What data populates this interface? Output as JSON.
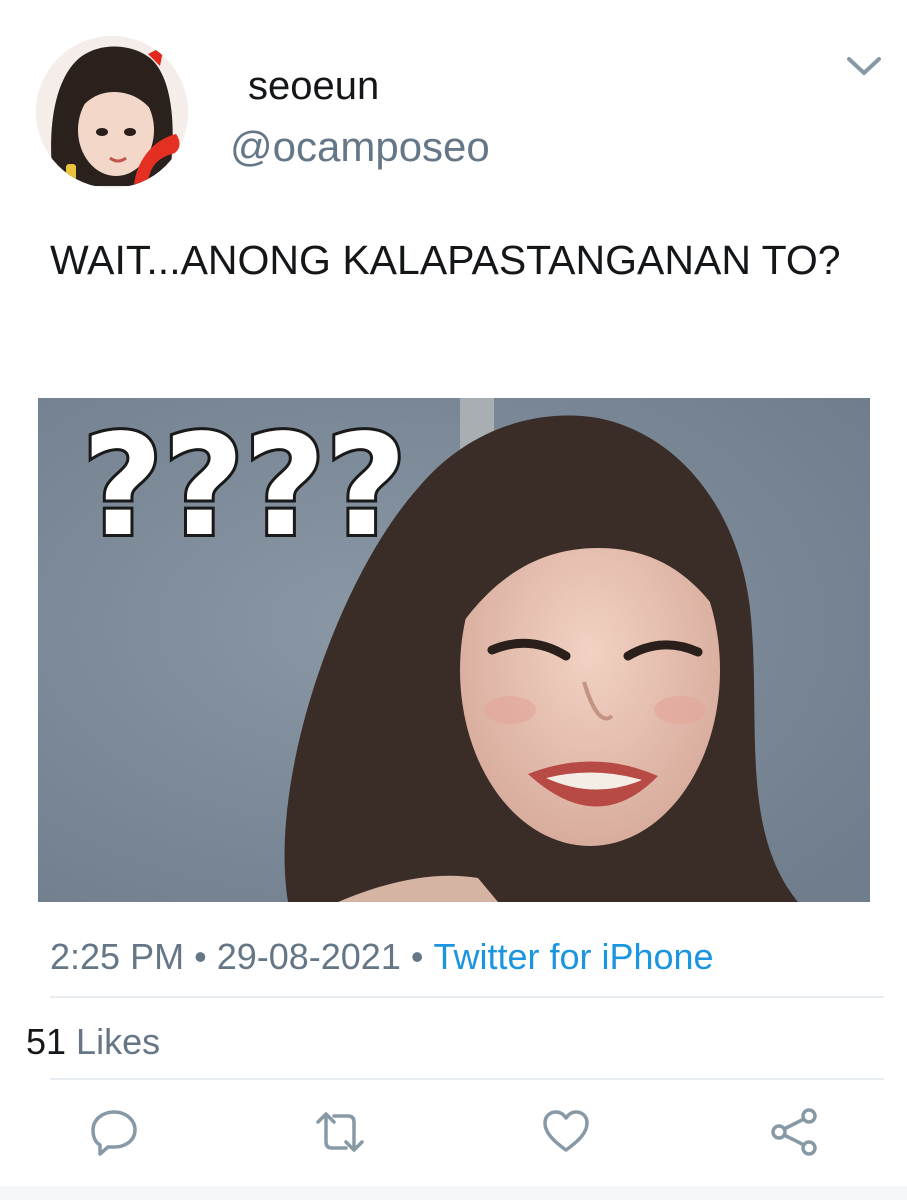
{
  "author": {
    "display_name": "seoeun",
    "handle": "@ocamposeo"
  },
  "tweet": {
    "text": "WAIT...ANONG KALAPASTANGANAN TO?",
    "media_overlay_text": "????"
  },
  "meta": {
    "time": "2:25 PM",
    "separator": "•",
    "date": "29-08-2021",
    "source": "Twitter for iPhone"
  },
  "stats": {
    "likes_count": "51",
    "likes_label": "Likes"
  },
  "icons": {
    "menu": "chevron-down-icon",
    "reply": "reply-icon",
    "retweet": "retweet-icon",
    "like": "heart-icon",
    "share": "share-icon"
  },
  "colors": {
    "primary_text": "#14171a",
    "secondary_text": "#657786",
    "link": "#1b95e0",
    "divider": "#e6ecf0",
    "icon": "#657786"
  }
}
